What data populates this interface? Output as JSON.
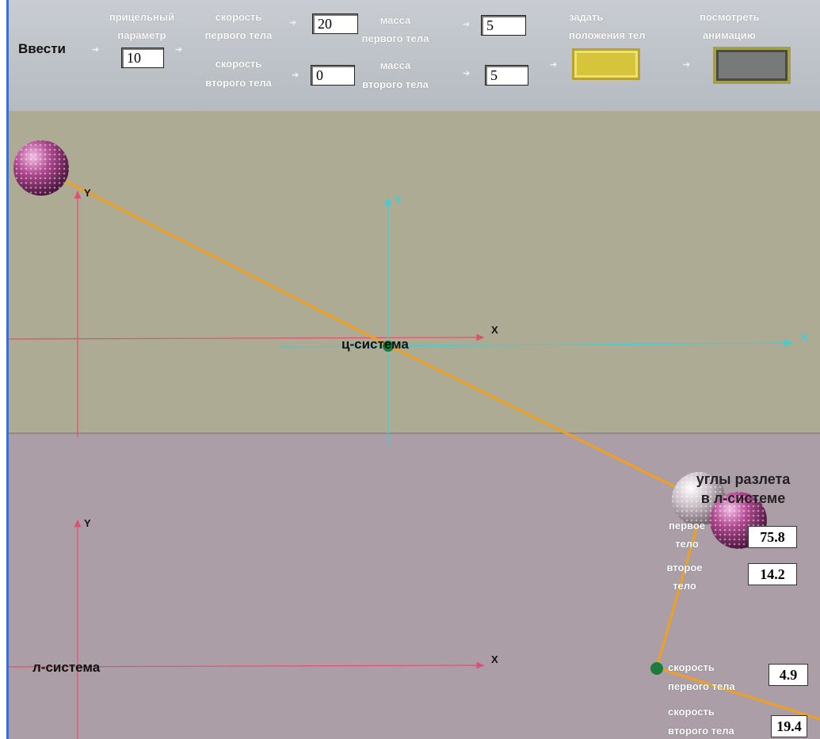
{
  "toolbar": {
    "enter_label": "Ввести",
    "impact_param": {
      "label_line1": "прицельный",
      "label_line2": "параметр",
      "value": "10"
    },
    "speed1": {
      "label_line1": "скорость",
      "label_line2": "первого тела",
      "value": "20"
    },
    "speed2": {
      "label_line1": "скорость",
      "label_line2": "второго тела",
      "value": "0"
    },
    "mass1": {
      "label_line1": "масса",
      "label_line2": "первого тела",
      "value": "5"
    },
    "mass2": {
      "label_line1": "масса",
      "label_line2": "второго тела",
      "value": "5"
    },
    "set_positions": {
      "label_line1": "задать",
      "label_line2": "положения тел"
    },
    "view_animation": {
      "label_line1": "посмотреть",
      "label_line2": "анимацию"
    }
  },
  "cm_system": {
    "label": "ц-система",
    "x_axis": "X",
    "y_axis": "Y"
  },
  "lab_system": {
    "label": "л-система",
    "x_axis": "X",
    "y_axis": "Y"
  },
  "angles": {
    "heading_line1": "углы разлета",
    "heading_line2": "в л-системе",
    "first_body": {
      "label_line1": "первое",
      "label_line2": "тело",
      "value": "75.8"
    },
    "second_body": {
      "label_line1": "второе",
      "label_line2": "тело",
      "value": "14.2"
    }
  },
  "speeds_out": {
    "first": {
      "label_line1": "скорость",
      "label_line2": "первого тела",
      "value": "4.9"
    },
    "second": {
      "label_line1": "скорость",
      "label_line2": "второго тела",
      "value": "19.4"
    }
  },
  "colors": {
    "trajectory": "#f0a020",
    "lab_axes": "#e05070",
    "cm_axes": "#3ad0d8",
    "cm_panel": "#aeab94",
    "lab_panel": "#ab9ea6",
    "ball": "#b04890"
  }
}
